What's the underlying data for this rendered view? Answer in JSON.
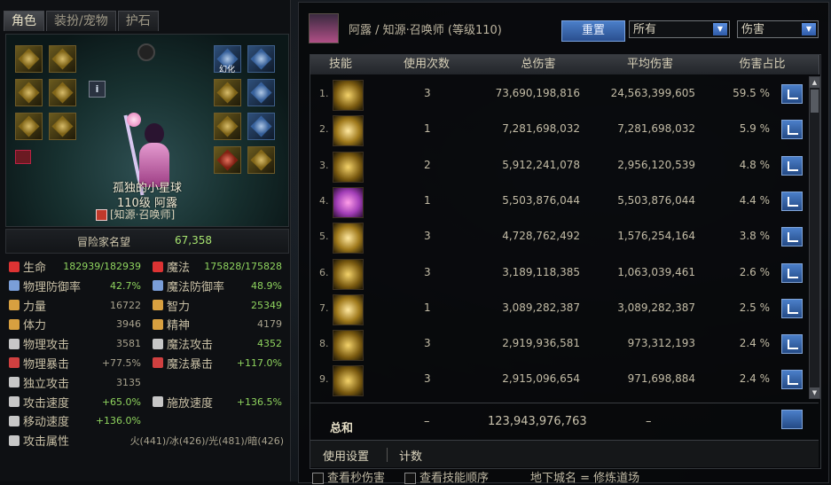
{
  "left": {
    "tabs": [
      "角色",
      "装扮/宠物",
      "护石"
    ],
    "character": {
      "name": "孤独的小星球",
      "level_line": "110级 阿露",
      "job": "[知源·召唤师]"
    },
    "fame": {
      "label": "冒险家名望",
      "value": "67,358"
    },
    "stats": [
      {
        "left": {
          "name": "生命",
          "value": "182939/182939",
          "color": "green"
        },
        "right": {
          "name": "魔法",
          "value": "175828/175828",
          "color": "green"
        }
      },
      {
        "left": {
          "name": "物理防御率",
          "value": "42.7%",
          "color": "green"
        },
        "right": {
          "name": "魔法防御率",
          "value": "48.9%",
          "color": "green"
        }
      },
      {
        "left": {
          "name": "力量",
          "value": "16722",
          "color": "gray"
        },
        "right": {
          "name": "智力",
          "value": "25349",
          "color": "green"
        }
      },
      {
        "left": {
          "name": "体力",
          "value": "3946",
          "color": "gray"
        },
        "right": {
          "name": "精神",
          "value": "4179",
          "color": "gray"
        }
      },
      {
        "left": {
          "name": "物理攻击",
          "value": "3581",
          "color": "gray"
        },
        "right": {
          "name": "魔法攻击",
          "value": "4352",
          "color": "green"
        }
      },
      {
        "left": {
          "name": "物理暴击",
          "value": "+77.5%",
          "color": "gray"
        },
        "right": {
          "name": "魔法暴击",
          "value": "+117.0%",
          "color": "green"
        }
      },
      {
        "left": {
          "name": "独立攻击",
          "value": "3135",
          "color": "gray"
        },
        "right": {
          "name": "",
          "value": "",
          "color": "gray"
        }
      },
      {
        "left": {
          "name": "攻击速度",
          "value": "+65.0%",
          "color": "green"
        },
        "right": {
          "name": "施放速度",
          "value": "+136.5%",
          "color": "green"
        }
      },
      {
        "left": {
          "name": "移动速度",
          "value": "+136.0%",
          "color": "green"
        },
        "right": {
          "name": "",
          "value": "",
          "color": "gray"
        }
      },
      {
        "left": {
          "name": "攻击属性",
          "value": "火(441)/冰(426)/光(481)/暗(426)",
          "color": "gray"
        },
        "right": {
          "name": "",
          "value": "",
          "color": "gray"
        }
      }
    ],
    "slot_labels": {
      "huanhua": "幻化"
    }
  },
  "right": {
    "title": "阿露 / 知源·召唤师 (等级110)",
    "reset_label": "重置",
    "filter_select": "所有",
    "mode_select": "伤害",
    "headers": [
      "技能",
      "使用次数",
      "总伤害",
      "平均伤害",
      "伤害占比"
    ],
    "rows": [
      {
        "idx": "1.",
        "uses": "3",
        "total": "73,690,198,816",
        "avg": "24,563,399,605",
        "share": "59.5 %"
      },
      {
        "idx": "2.",
        "uses": "1",
        "total": "7,281,698,032",
        "avg": "7,281,698,032",
        "share": "5.9 %"
      },
      {
        "idx": "3.",
        "uses": "2",
        "total": "5,912,241,078",
        "avg": "2,956,120,539",
        "share": "4.8 %"
      },
      {
        "idx": "4.",
        "uses": "1",
        "total": "5,503,876,044",
        "avg": "5,503,876,044",
        "share": "4.4 %"
      },
      {
        "idx": "5.",
        "uses": "3",
        "total": "4,728,762,492",
        "avg": "1,576,254,164",
        "share": "3.8 %"
      },
      {
        "idx": "6.",
        "uses": "3",
        "total": "3,189,118,385",
        "avg": "1,063,039,461",
        "share": "2.6 %"
      },
      {
        "idx": "7.",
        "uses": "1",
        "total": "3,089,282,387",
        "avg": "3,089,282,387",
        "share": "2.5 %"
      },
      {
        "idx": "8.",
        "uses": "3",
        "total": "2,919,936,581",
        "avg": "973,312,193",
        "share": "2.4 %"
      },
      {
        "idx": "9.",
        "uses": "3",
        "total": "2,915,096,654",
        "avg": "971,698,884",
        "share": "2.4 %"
      }
    ],
    "total": {
      "label": "总和",
      "uses": "–",
      "total": "123,943,976,763",
      "avg": "–"
    },
    "footer_tabs": {
      "settings": "使用设置",
      "count": "计数"
    },
    "bottom": {
      "check1": "查看秒伤害",
      "check2": "查看技能顺序",
      "dungeon": "地下城名 = 修炼道场"
    }
  }
}
